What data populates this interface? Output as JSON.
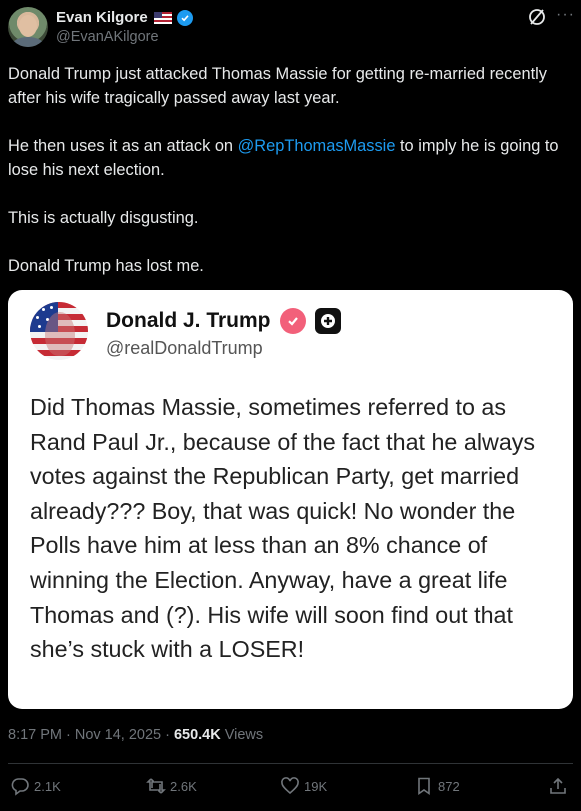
{
  "author": {
    "name": "Evan Kilgore",
    "handle": "@EvanAKilgore"
  },
  "tweet": {
    "paragraphs": [
      "Donald Trump just attacked Thomas Massie for getting re-married recently after his wife tragically passed away last year.",
      "This is actually disgusting.",
      "Donald Trump has lost me."
    ],
    "p2_before": "He then uses it as an attack on ",
    "p2_mention": "@RepThomasMassie",
    "p2_after": " to imply he is going to lose his next election."
  },
  "embedded_post": {
    "name": "Donald J. Trump",
    "handle": "@realDonaldTrump",
    "body": "Did Thomas Massie, sometimes referred to as Rand Paul Jr., because of the fact that he always votes against the Republican Party, get married already??? Boy, that was quick! No wonder the Polls have him at less than an 8% chance of winning the Election. Anyway, have a great life Thomas and (?). His wife will soon find out that she’s stuck with a LOSER!"
  },
  "meta": {
    "time": "8:17 PM",
    "date": "Nov 14, 2025",
    "views_count": "650.4K",
    "views_label": "Views"
  },
  "actions": {
    "replies": "2.1K",
    "reposts": "2.6K",
    "likes": "19K",
    "bookmarks": "872"
  },
  "colors": {
    "background": "#000000",
    "accent": "#1d9bf0",
    "muted": "#71767b"
  }
}
